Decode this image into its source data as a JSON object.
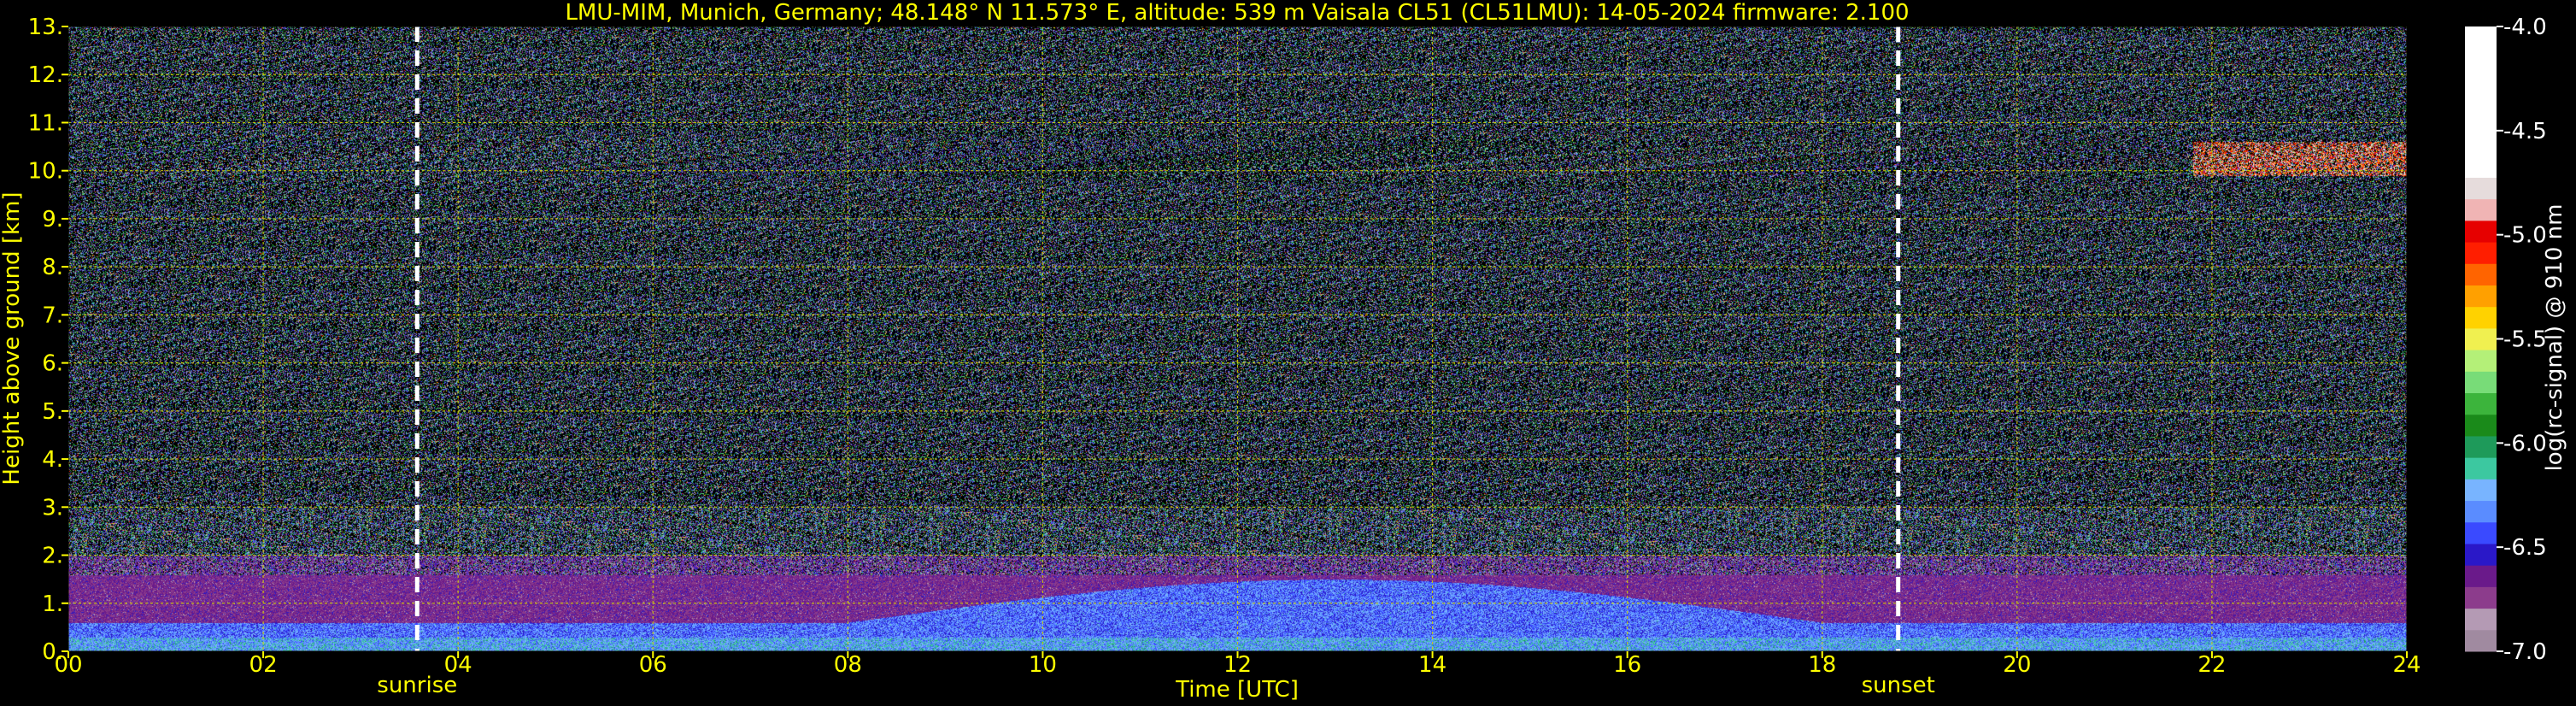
{
  "chart_data": {
    "type": "heatmap",
    "title": "LMU-MIM, Munich, Germany; 48.148° N 11.573° E, altitude: 539 m    Vaisala CL51 (CL51LMU): 14-05-2024    firmware: 2.100",
    "xlabel": "Time [UTC]",
    "ylabel": "Height above ground [km]",
    "colorbar_label": "log(rc-signal) @ 910 nm",
    "xlim": [
      0,
      24
    ],
    "ylim": [
      0,
      13
    ],
    "x_ticks": [
      0,
      2,
      4,
      6,
      8,
      10,
      12,
      14,
      16,
      18,
      20,
      22,
      24
    ],
    "x_tick_labels": [
      "00",
      "02",
      "04",
      "06",
      "08",
      "10",
      "12",
      "14",
      "16",
      "18",
      "20",
      "22",
      "24"
    ],
    "y_ticks": [
      0,
      1,
      2,
      3,
      4,
      5,
      6,
      7,
      8,
      9,
      10,
      11,
      12,
      13
    ],
    "y_tick_labels": [
      "0.",
      "1.",
      "2.",
      "3.",
      "4.",
      "5.",
      "6.",
      "7.",
      "8.",
      "9.",
      "10.",
      "11.",
      "12.",
      "13."
    ],
    "colorbar_range": [
      -7.0,
      -4.0
    ],
    "colorbar_ticks": [
      -7.0,
      -6.5,
      -6.0,
      -5.5,
      -5.0,
      -4.5,
      -4.0
    ],
    "colorbar_tick_labels": [
      "-7.0",
      "-6.5",
      "-6.0",
      "-5.5",
      "-5.0",
      "-4.5",
      "-4.0"
    ],
    "colorbar_colors": [
      "#a08aa0",
      "#b49ab4",
      "#8c3c8c",
      "#6a1a8a",
      "#2a18c8",
      "#3a4aff",
      "#5a8cff",
      "#78b4ff",
      "#3cc8a0",
      "#1e9a5a",
      "#1a8a1a",
      "#3cb43c",
      "#78dc78",
      "#b4f078",
      "#f0f050",
      "#ffd200",
      "#ffa000",
      "#ff6400",
      "#ff1e00",
      "#e60000",
      "#f0b4b4",
      "#e6dcdc",
      "#ffffff"
    ],
    "grid": true,
    "markers": [
      {
        "label": "sunrise",
        "x": 3.58
      },
      {
        "label": "sunset",
        "x": 18.78
      }
    ],
    "layers": [
      {
        "name": "noise",
        "from_km": 2.0,
        "to_km": 13.0,
        "level": -6.5
      },
      {
        "name": "residual-layer",
        "from_km": 1.0,
        "to_km": 2.0,
        "level": -6.6
      },
      {
        "name": "mixed-layer",
        "from_km": 0.0,
        "to_km": 1.6,
        "level": -6.2
      },
      {
        "name": "cirrus",
        "from_time": 21.8,
        "to_time": 24.0,
        "from_km": 9.9,
        "to_km": 10.6,
        "level": -4.5
      }
    ],
    "colors": {
      "text": "#ffff00",
      "colorbar_text": "#ffffff",
      "grid": "#d2d200",
      "marker": "#ffffff",
      "background": "#000000"
    }
  }
}
